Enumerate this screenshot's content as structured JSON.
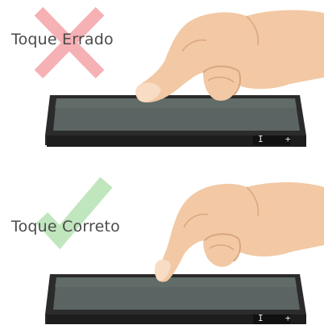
{
  "examples": [
    {
      "caption": "Toque Errado",
      "status_icon": "cross-icon",
      "status_color": "#f6a9ad",
      "minus_label": "I",
      "plus_label": "+"
    },
    {
      "caption": "Toque Correto",
      "status_icon": "check-icon",
      "status_color": "#bde5ba",
      "minus_label": "I",
      "plus_label": "+"
    }
  ],
  "colors": {
    "device_frame": "#2b2b2b",
    "screen": "#5b6462",
    "skin": "#f2c9a4",
    "skin_shadow": "#d9a67e",
    "caption_text": "#4a4a4a"
  }
}
